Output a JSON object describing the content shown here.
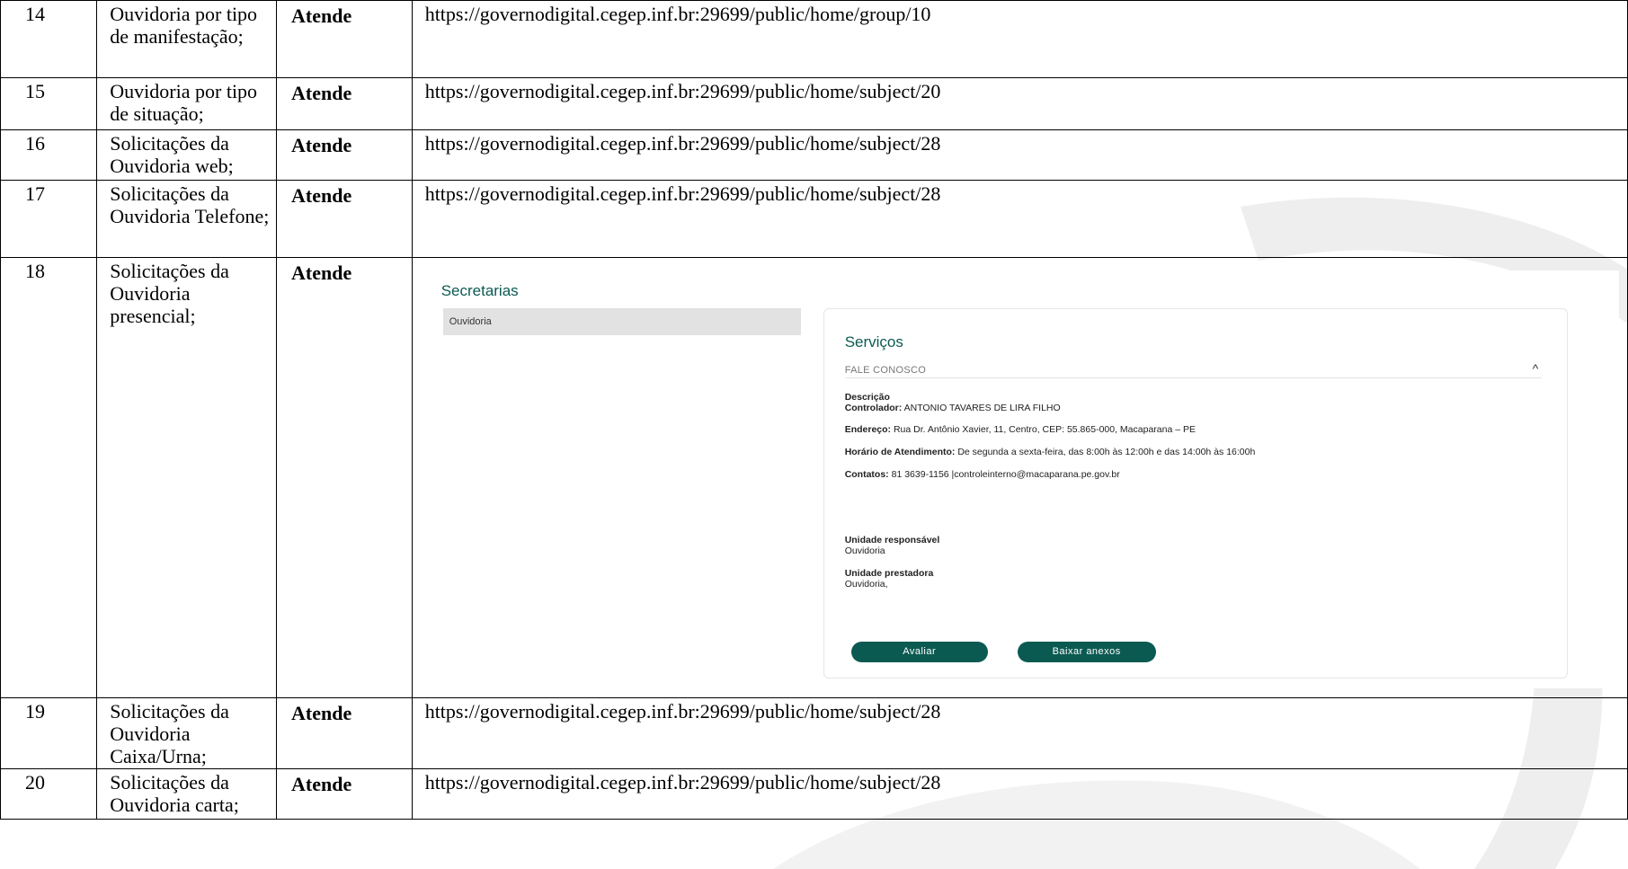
{
  "rows_before": [
    {
      "num": "14",
      "item": "Ouvidoria por tipo de manifestação;",
      "status": "Atende",
      "link": "https://governodigital.cegep.inf.br:29699/public/home/group/10"
    },
    {
      "num": "15",
      "item": "Ouvidoria por tipo de situação;",
      "status": "Atende",
      "link": "https://governodigital.cegep.inf.br:29699/public/home/subject/20"
    },
    {
      "num": "16",
      "item": "Solicitações da Ouvidoria web;",
      "status": "Atende",
      "link": "https://governodigital.cegep.inf.br:29699/public/home/subject/28"
    },
    {
      "num": "17",
      "item": "Solicitações da Ouvidoria Telefone;",
      "status": "Atende",
      "link": "https://governodigital.cegep.inf.br:29699/public/home/subject/28"
    }
  ],
  "row18": {
    "num": "18",
    "item": "Solicitações da Ouvidoria presencial;",
    "status": "Atende",
    "screenshot": {
      "sec_title": "Secretarias",
      "sec_item": "Ouvidoria",
      "svc_title": "Serviços",
      "fale": "FALE CONOSCO",
      "chevron": "^",
      "desc_label": "Descrição",
      "controlador_label": "Controlador:",
      "controlador_value": "ANTONIO TAVARES DE LIRA FILHO",
      "endereco_label": "Endereço:",
      "endereco_value": "Rua Dr. Antônio Xavier, 11, Centro, CEP: 55.865-000, Macaparana – PE",
      "horario_label": "Horário de Atendimento:",
      "horario_value": "De segunda a sexta-feira, das 8:00h às 12:00h e das 14:00h às 16:00h",
      "contatos_label": "Contatos:",
      "contatos_value": "81 3639-1156 |controleinterno@macaparana.pe.gov.br",
      "resp_label": "Unidade responsável",
      "resp_value": "Ouvidoria",
      "prest_label": "Unidade prestadora",
      "prest_value": "Ouvidoria,",
      "btn_avaliar": "Avaliar",
      "btn_baixar": "Baixar anexos"
    }
  },
  "rows_after": [
    {
      "num": "19",
      "item": "Solicitações da Ouvidoria Caixa/Urna;",
      "status": "Atende",
      "link": "https://governodigital.cegep.inf.br:29699/public/home/subject/28"
    },
    {
      "num": "20",
      "item": "Solicitações da Ouvidoria carta;",
      "status": "Atende",
      "link": "https://governodigital.cegep.inf.br:29699/public/home/subject/28"
    }
  ]
}
